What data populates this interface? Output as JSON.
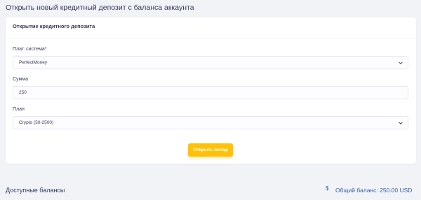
{
  "page": {
    "title": "Открыть новый кредитный депозит с баланса аккаунта"
  },
  "card": {
    "header": "Открытие кредитного депозита",
    "payment_system": {
      "label": "Плат. система*",
      "value": "PerfectMoney"
    },
    "amount": {
      "label": "Сумма",
      "value": "250"
    },
    "plan": {
      "label": "План",
      "value": "Crypto (50-2500)"
    },
    "submit_label": "Открыть вклад"
  },
  "balances": {
    "title": "Доступные балансы",
    "currency_symbol": "$",
    "total_label": "Общий баланс: 250.00 USD"
  },
  "colors": {
    "accent": "#ffc107",
    "link": "#3b5da8",
    "text": "#34395e",
    "background": "#f1f3f7"
  }
}
